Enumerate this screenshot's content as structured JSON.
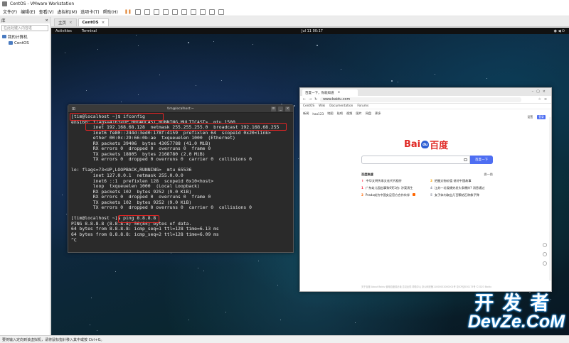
{
  "window": {
    "title": "CentOS - VMware Workstation"
  },
  "menu": [
    "文件(F)",
    "编辑(E)",
    "查看(V)",
    "虚拟机(M)",
    "选项卡(T)",
    "帮助(H)"
  ],
  "library": {
    "title": "库",
    "close": "×",
    "search_placeholder": "在此处键入内容进",
    "root": "我的计算机",
    "vm": "CentOS"
  },
  "tabs": [
    {
      "label": "主页",
      "close": "×"
    },
    {
      "label": "CentOS",
      "close": "×"
    }
  ],
  "gnome": {
    "activities": "Activities",
    "app": "Terminal",
    "clock": "Jul 11 00:17"
  },
  "terminal": {
    "title": "tim@localhost:~",
    "lines": [
      "[tim@localhost ~]$ ifconfig",
      "ens160: flags=4163<UP,BROADCAST,RUNNING,MULTICAST>  mtu 1500",
      "        inet 192.168.68.128  netmask 255.255.255.0  broadcast 192.168.68.255",
      "        inet6 fe80::244d:3ed0:178f:4159  prefixlen 64  scopeid 0x20<link>",
      "        ether 00:0c:29:66:0b:ae  txqueuelen 1000  (Ethernet)",
      "        RX packets 39406  bytes 43057788 (41.0 MiB)",
      "        RX errors 0  dropped 0  overruns 0  frame 0",
      "        TX packets 18805  bytes 2168780 (2.0 MiB)",
      "        TX errors 0  dropped 0 overruns 0  carrier 0  collisions 0",
      "",
      "lo: flags=73<UP,LOOPBACK,RUNNING>  mtu 65536",
      "        inet 127.0.0.1  netmask 255.0.0.0",
      "        inet6 ::1  prefixlen 128  scopeid 0x10<host>",
      "        loop  txqueuelen 1000  (Local Loopback)",
      "        RX packets 102  bytes 9252 (9.0 KiB)",
      "        RX errors 0  dropped 0  overruns 0  frame 0",
      "        TX packets 102  bytes 9252 (9.0 KiB)",
      "        TX errors 0  dropped 0 overruns 0  carrier 0  collisions 0",
      "",
      "[tim@localhost ~]$ ping 8.8.8.8",
      "PING 8.8.8.8 (8.8.8.8) 56(84) bytes of data.",
      "64 bytes from 8.8.8.8: icmp_seq=1 ttl=128 time=6.13 ms",
      "64 bytes from 8.8.8.8: icmp_seq=2 ttl=128 time=6.09 ms",
      "^C"
    ]
  },
  "browser": {
    "tab_title": "百度一下，你就知道",
    "url": "www.baidu.com",
    "bookmarks": [
      "CentOS",
      "Wiki",
      "Documentation",
      "Forums"
    ],
    "nav": [
      "新闻",
      "hao123",
      "地图",
      "贴吧",
      "视频",
      "图片",
      "网盘",
      "更多"
    ],
    "setting": "设置",
    "login": "登录",
    "logo_text": "Bai",
    "logo_paw": "du",
    "logo_cn": "百度",
    "search_button": "百度一下",
    "hot_title": "百度热搜",
    "hot_swap": "换一换",
    "hot_items": [
      {
        "rank": "",
        "text": "中华文明传承文化代代相传"
      },
      {
        "rank": "1",
        "text": "广东幼儿园出事致6死1伤: 涉案男生"
      },
      {
        "rank": "2",
        "text": "Prada成为中国女足官方合作伙伴"
      },
      {
        "rank": "3",
        "text": "把握文物价值 讲好中国故事"
      },
      {
        "rank": "4",
        "text": "江苏一垃圾桶突发头条爆炸? 消息通过"
      },
      {
        "rank": "5",
        "text": "女子体内取出几百颗结石称像子弹"
      }
    ],
    "footer": "关于百度  About Baidu  使用百度前必读  意见反馈  帮助中心  京公网安备11000002000001号  京ICP证030173号  ©2023 Baidu"
  },
  "watermark": {
    "cn": "开发者",
    "en": "DevZe.CoM"
  },
  "status": {
    "text": "要将输入定向到该虚拟机，请将鼠标指针移入其中或按 Ctrl+G。"
  }
}
